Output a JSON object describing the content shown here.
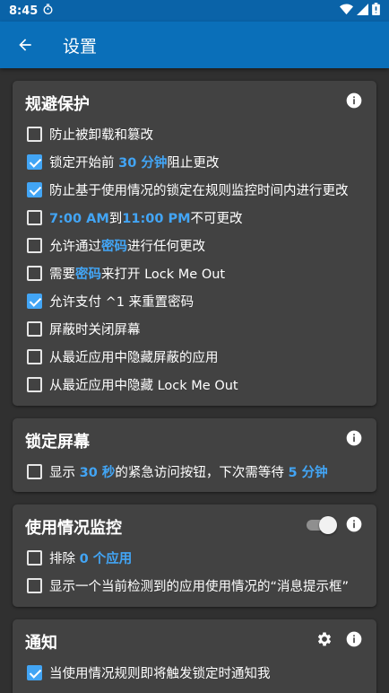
{
  "status": {
    "time": "8:45"
  },
  "appbar": {
    "title": "设置"
  },
  "colors": {
    "accent": "#42a5f5",
    "appbar": "#0a6fb9",
    "card": "#424242",
    "background": "#303030"
  },
  "sections": {
    "protection": {
      "title": "规避保护",
      "items": [
        {
          "checked": false,
          "parts": [
            "防止被卸载和篡改"
          ]
        },
        {
          "checked": true,
          "parts": [
            "锁定开始前 ",
            "30 分钟",
            "阻止更改"
          ]
        },
        {
          "checked": true,
          "parts": [
            "防止基于使用情况的锁定在规则监控时间内进行更改"
          ]
        },
        {
          "checked": false,
          "parts": [
            "",
            "7:00 AM",
            "到",
            "11:00 PM",
            "不可更改"
          ]
        },
        {
          "checked": false,
          "parts": [
            "允许通过",
            "密码",
            "进行任何更改"
          ]
        },
        {
          "checked": false,
          "parts": [
            "需要",
            "密码",
            "来打开 Lock Me Out"
          ]
        },
        {
          "checked": true,
          "parts": [
            "允许支付 ^1 来重置密码"
          ]
        },
        {
          "checked": false,
          "parts": [
            "屏蔽时关闭屏幕"
          ]
        },
        {
          "checked": false,
          "parts": [
            "从最近应用中隐藏屏蔽的应用"
          ]
        },
        {
          "checked": false,
          "parts": [
            "从最近应用中隐藏 Lock Me Out"
          ]
        }
      ]
    },
    "lockscreen": {
      "title": "锁定屏幕",
      "items": [
        {
          "checked": false,
          "parts": [
            "显示 ",
            "30 秒",
            "的紧急访问按钮，下次需等待 ",
            "5 分钟"
          ]
        }
      ]
    },
    "usage": {
      "title": "使用情况监控",
      "toggle_on": true,
      "items": [
        {
          "checked": false,
          "parts": [
            "排除 ",
            "0 个应用"
          ]
        },
        {
          "checked": false,
          "parts": [
            "显示一个当前检测到的应用使用情况的“消息提示框”"
          ]
        }
      ]
    },
    "notify": {
      "title": "通知",
      "items": [
        {
          "checked": true,
          "parts": [
            "当使用情况规则即将触发锁定时通知我"
          ]
        }
      ]
    }
  }
}
